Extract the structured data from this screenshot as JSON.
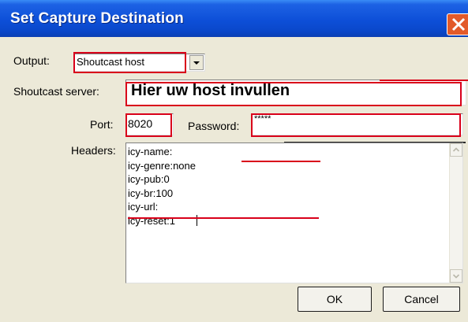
{
  "window": {
    "title": "Set Capture Destination"
  },
  "output": {
    "label": "Output:",
    "selected": "Shoutcast host"
  },
  "server": {
    "label": "Shoutcast server:",
    "value": "Hier uw host invullen"
  },
  "port": {
    "label": "Port:",
    "value": "8020"
  },
  "password": {
    "label": "Password:",
    "value": "*****"
  },
  "headers": {
    "label": "Headers:",
    "lines": [
      "icy-name:",
      "icy-genre:none",
      "icy-pub:0",
      "icy-br:100",
      "icy-url:",
      "icy-reset:1"
    ]
  },
  "buttons": {
    "ok": "OK",
    "cancel": "Cancel"
  },
  "annotation_color": "#d9001a"
}
